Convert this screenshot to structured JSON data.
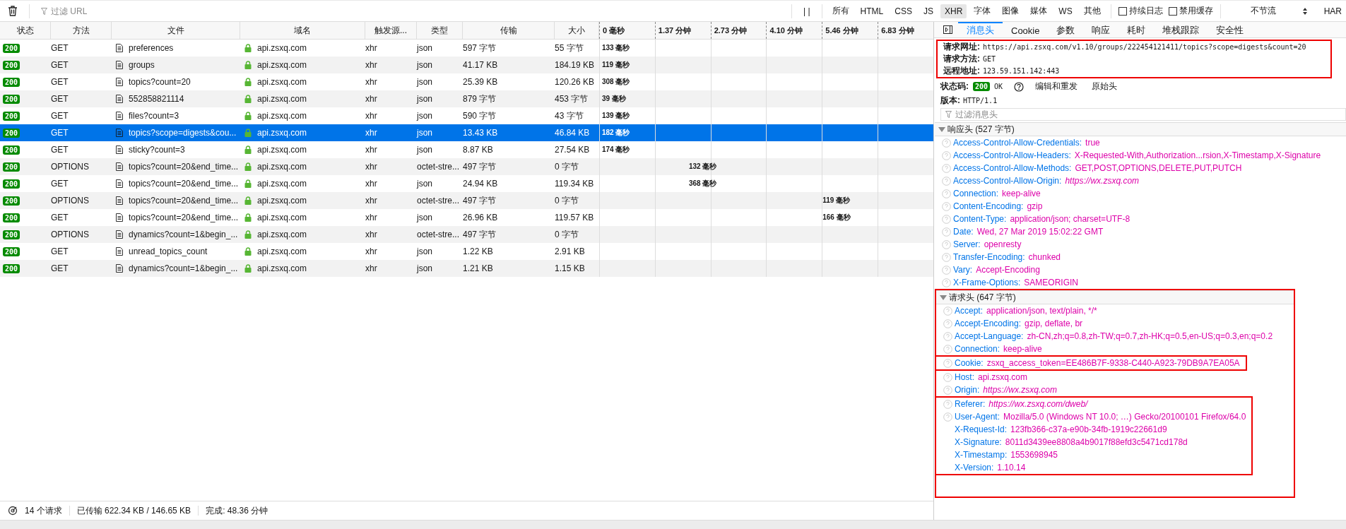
{
  "toolbar": {
    "filter": {
      "placeholder": "过滤 URL"
    },
    "pause": "| |",
    "type_filters": [
      {
        "label": "所有",
        "selected": false
      },
      {
        "label": "HTML",
        "selected": false
      },
      {
        "label": "CSS",
        "selected": false
      },
      {
        "label": "JS",
        "selected": false
      },
      {
        "label": "XHR",
        "selected": true
      },
      {
        "label": "字体",
        "selected": false
      },
      {
        "label": "图像",
        "selected": false
      },
      {
        "label": "媒体",
        "selected": false
      },
      {
        "label": "WS",
        "selected": false
      },
      {
        "label": "其他",
        "selected": false
      }
    ],
    "checkboxes": [
      {
        "label": "持续日志",
        "checked": false
      },
      {
        "label": "禁用缓存",
        "checked": false
      }
    ],
    "throttle": "不节流",
    "har": "HAR"
  },
  "table": {
    "columns": [
      "状态",
      "方法",
      "文件",
      "域名",
      "触发源...",
      "类型",
      "传输",
      "大小"
    ],
    "waterfall_ticks": [
      "0 毫秒",
      "1.37 分钟",
      "2.73 分钟",
      "4.10 分钟",
      "5.46 分钟",
      "6.83 分钟"
    ],
    "rows": [
      {
        "status": "200",
        "method": "GET",
        "file": "preferences",
        "domain": "api.zsxq.com",
        "initiator": "xhr",
        "type": "json",
        "transferred": "597 字节",
        "size": "55 字节",
        "timing": "133 毫秒",
        "kind": "early",
        "selected": false
      },
      {
        "status": "200",
        "method": "GET",
        "file": "groups",
        "domain": "api.zsxq.com",
        "initiator": "xhr",
        "type": "json",
        "transferred": "41.17 KB",
        "size": "184.19 KB",
        "timing": "119 毫秒",
        "kind": "early",
        "selected": false
      },
      {
        "status": "200",
        "method": "GET",
        "file": "topics?count=20",
        "domain": "api.zsxq.com",
        "initiator": "xhr",
        "type": "json",
        "transferred": "25.39 KB",
        "size": "120.26 KB",
        "timing": "308 毫秒",
        "kind": "early",
        "selected": false
      },
      {
        "status": "200",
        "method": "GET",
        "file": "552858821114",
        "domain": "api.zsxq.com",
        "initiator": "xhr",
        "type": "json",
        "transferred": "879 字节",
        "size": "453 字节",
        "timing": "39 毫秒",
        "kind": "early",
        "selected": false
      },
      {
        "status": "200",
        "method": "GET",
        "file": "files?count=3",
        "domain": "api.zsxq.com",
        "initiator": "xhr",
        "type": "json",
        "transferred": "590 字节",
        "size": "43 字节",
        "timing": "139 毫秒",
        "kind": "early",
        "selected": false
      },
      {
        "status": "200",
        "method": "GET",
        "file": "topics?scope=digests&cou...",
        "domain": "api.zsxq.com",
        "initiator": "xhr",
        "type": "json",
        "transferred": "13.43 KB",
        "size": "46.84 KB",
        "timing": "182 毫秒",
        "kind": "early",
        "selected": true
      },
      {
        "status": "200",
        "method": "GET",
        "file": "sticky?count=3",
        "domain": "api.zsxq.com",
        "initiator": "xhr",
        "type": "json",
        "transferred": "8.87 KB",
        "size": "27.54 KB",
        "timing": "174 毫秒",
        "kind": "early",
        "selected": false
      },
      {
        "status": "200",
        "method": "OPTIONS",
        "file": "topics?count=20&end_time...",
        "domain": "api.zsxq.com",
        "initiator": "xhr",
        "type": "octet-stre...",
        "transferred": "497 字节",
        "size": "0 字节",
        "timing": "132 毫秒",
        "kind": "middle",
        "selected": false
      },
      {
        "status": "200",
        "method": "GET",
        "file": "topics?count=20&end_time...",
        "domain": "api.zsxq.com",
        "initiator": "xhr",
        "type": "json",
        "transferred": "24.94 KB",
        "size": "119.34 KB",
        "timing": "368 毫秒",
        "kind": "middle",
        "selected": false
      },
      {
        "status": "200",
        "method": "OPTIONS",
        "file": "topics?count=20&end_time...",
        "domain": "api.zsxq.com",
        "initiator": "xhr",
        "type": "octet-stre...",
        "transferred": "497 字节",
        "size": "0 字节",
        "timing": "119 毫秒",
        "kind": "late",
        "selected": false
      },
      {
        "status": "200",
        "method": "GET",
        "file": "topics?count=20&end_time...",
        "domain": "api.zsxq.com",
        "initiator": "xhr",
        "type": "json",
        "transferred": "26.96 KB",
        "size": "119.57 KB",
        "timing": "166 毫秒",
        "kind": "late",
        "selected": false
      },
      {
        "status": "200",
        "method": "OPTIONS",
        "file": "dynamics?count=1&begin_...",
        "domain": "api.zsxq.com",
        "initiator": "xhr",
        "type": "octet-stre...",
        "transferred": "497 字节",
        "size": "0 字节",
        "selected": false
      },
      {
        "status": "200",
        "method": "GET",
        "file": "unread_topics_count",
        "domain": "api.zsxq.com",
        "initiator": "xhr",
        "type": "json",
        "transferred": "1.22 KB",
        "size": "2.91 KB",
        "selected": false
      },
      {
        "status": "200",
        "method": "GET",
        "file": "dynamics?count=1&begin_...",
        "domain": "api.zsxq.com",
        "initiator": "xhr",
        "type": "json",
        "transferred": "1.21 KB",
        "size": "1.15 KB",
        "selected": false
      }
    ]
  },
  "status_bar": {
    "requests": "14 个请求",
    "transferred": "已传输 622.34 KB / 146.65 KB",
    "finished": "完成: 48.36 分钟"
  },
  "details": {
    "tabs": [
      {
        "label": "消息头",
        "selected": true
      },
      {
        "label": "Cookie",
        "selected": false
      },
      {
        "label": "参数",
        "selected": false
      },
      {
        "label": "响应",
        "selected": false
      },
      {
        "label": "耗时",
        "selected": false
      },
      {
        "label": "堆栈跟踪",
        "selected": false
      },
      {
        "label": "安全性",
        "selected": false
      }
    ],
    "summary": {
      "boxed": true,
      "fields": [
        {
          "label": "请求网址:",
          "value": "https://api.zsxq.com/v1.10/groups/222454121411/topics?scope=digests&count=20"
        },
        {
          "label": "请求方法:",
          "value": "GET"
        },
        {
          "label": "远程地址:",
          "value": "123.59.151.142:443"
        }
      ]
    },
    "status": {
      "label": "状态码:",
      "code": "200",
      "text": "OK",
      "edit_resend": "编辑和重发",
      "raw_headers": "原始头"
    },
    "version": {
      "label": "版本:",
      "value": "HTTP/1.1"
    },
    "filter": {
      "placeholder": "过滤消息头"
    },
    "response_headers": {
      "title": "响应头 (527 字节)",
      "expanded": true,
      "items": [
        {
          "name": "Access-Control-Allow-Credentials:",
          "value": "true",
          "kind": "text",
          "help": true
        },
        {
          "name": "Access-Control-Allow-Headers:",
          "value": "X-Requested-With,Authorization...rsion,X-Timestamp,X-Signature",
          "kind": "text",
          "help": true
        },
        {
          "name": "Access-Control-Allow-Methods:",
          "value": "GET,POST,OPTIONS,DELETE,PUT,PUTCH",
          "kind": "text",
          "help": true
        },
        {
          "name": "Access-Control-Allow-Origin:",
          "value": "https://wx.zsxq.com",
          "kind": "url",
          "help": true
        },
        {
          "name": "Connection:",
          "value": "keep-alive",
          "kind": "text",
          "help": true
        },
        {
          "name": "Content-Encoding:",
          "value": "gzip",
          "kind": "text",
          "help": true
        },
        {
          "name": "Content-Type:",
          "value": "application/json; charset=UTF-8",
          "kind": "text",
          "help": true
        },
        {
          "name": "Date:",
          "value": "Wed, 27 Mar 2019 15:02:22 GMT",
          "kind": "text",
          "help": true
        },
        {
          "name": "Server:",
          "value": "openresty",
          "kind": "text",
          "help": true
        },
        {
          "name": "Transfer-Encoding:",
          "value": "chunked",
          "kind": "text",
          "help": true
        },
        {
          "name": "Vary:",
          "value": "Accept-Encoding",
          "kind": "text",
          "help": true
        },
        {
          "name": "X-Frame-Options:",
          "value": "SAMEORIGIN",
          "kind": "text",
          "help": true
        }
      ]
    },
    "request_headers": {
      "title": "请求头 (647 字节)",
      "expanded": true,
      "boxed": true,
      "groups": [
        {
          "boxed": false,
          "items": [
            {
              "name": "Accept:",
              "value": "application/json, text/plain, */*",
              "kind": "text",
              "help": true
            },
            {
              "name": "Accept-Encoding:",
              "value": "gzip, deflate, br",
              "kind": "text",
              "help": true
            },
            {
              "name": "Accept-Language:",
              "value": "zh-CN,zh;q=0.8,zh-TW;q=0.7,zh-HK;q=0.5,en-US;q=0.3,en;q=0.2",
              "kind": "text",
              "help": true
            },
            {
              "name": "Connection:",
              "value": "keep-alive",
              "kind": "text",
              "help": true
            }
          ]
        },
        {
          "boxed": true,
          "items": [
            {
              "name": "Cookie:",
              "value": "zsxq_access_token=EE486B7F-9338-C440-A923-79DB9A7EA05A",
              "kind": "text",
              "help": true
            }
          ]
        },
        {
          "boxed": false,
          "items": [
            {
              "name": "Host:",
              "value": "api.zsxq.com",
              "kind": "text",
              "help": true
            },
            {
              "name": "Origin:",
              "value": "https://wx.zsxq.com",
              "kind": "url",
              "help": true
            }
          ]
        },
        {
          "boxed": true,
          "items": [
            {
              "name": "Referer:",
              "value": "https://wx.zsxq.com/dweb/",
              "kind": "url",
              "help": true
            },
            {
              "name": "User-Agent:",
              "value": "Mozilla/5.0 (Windows NT 10.0; …) Gecko/20100101 Firefox/64.0",
              "kind": "text",
              "help": true
            },
            {
              "name": "X-Request-Id:",
              "value": "123fb366-c37a-e90b-34fb-1919c22661d9",
              "kind": "text",
              "help": false
            },
            {
              "name": "X-Signature:",
              "value": "8011d3439ee8808a4b9017f88efd3c5471cd178d",
              "kind": "text",
              "help": false
            },
            {
              "name": "X-Timestamp:",
              "value": "1553698945",
              "kind": "text",
              "help": false
            },
            {
              "name": "X-Version:",
              "value": "1.10.14",
              "kind": "text",
              "help": false
            }
          ]
        }
      ]
    }
  }
}
